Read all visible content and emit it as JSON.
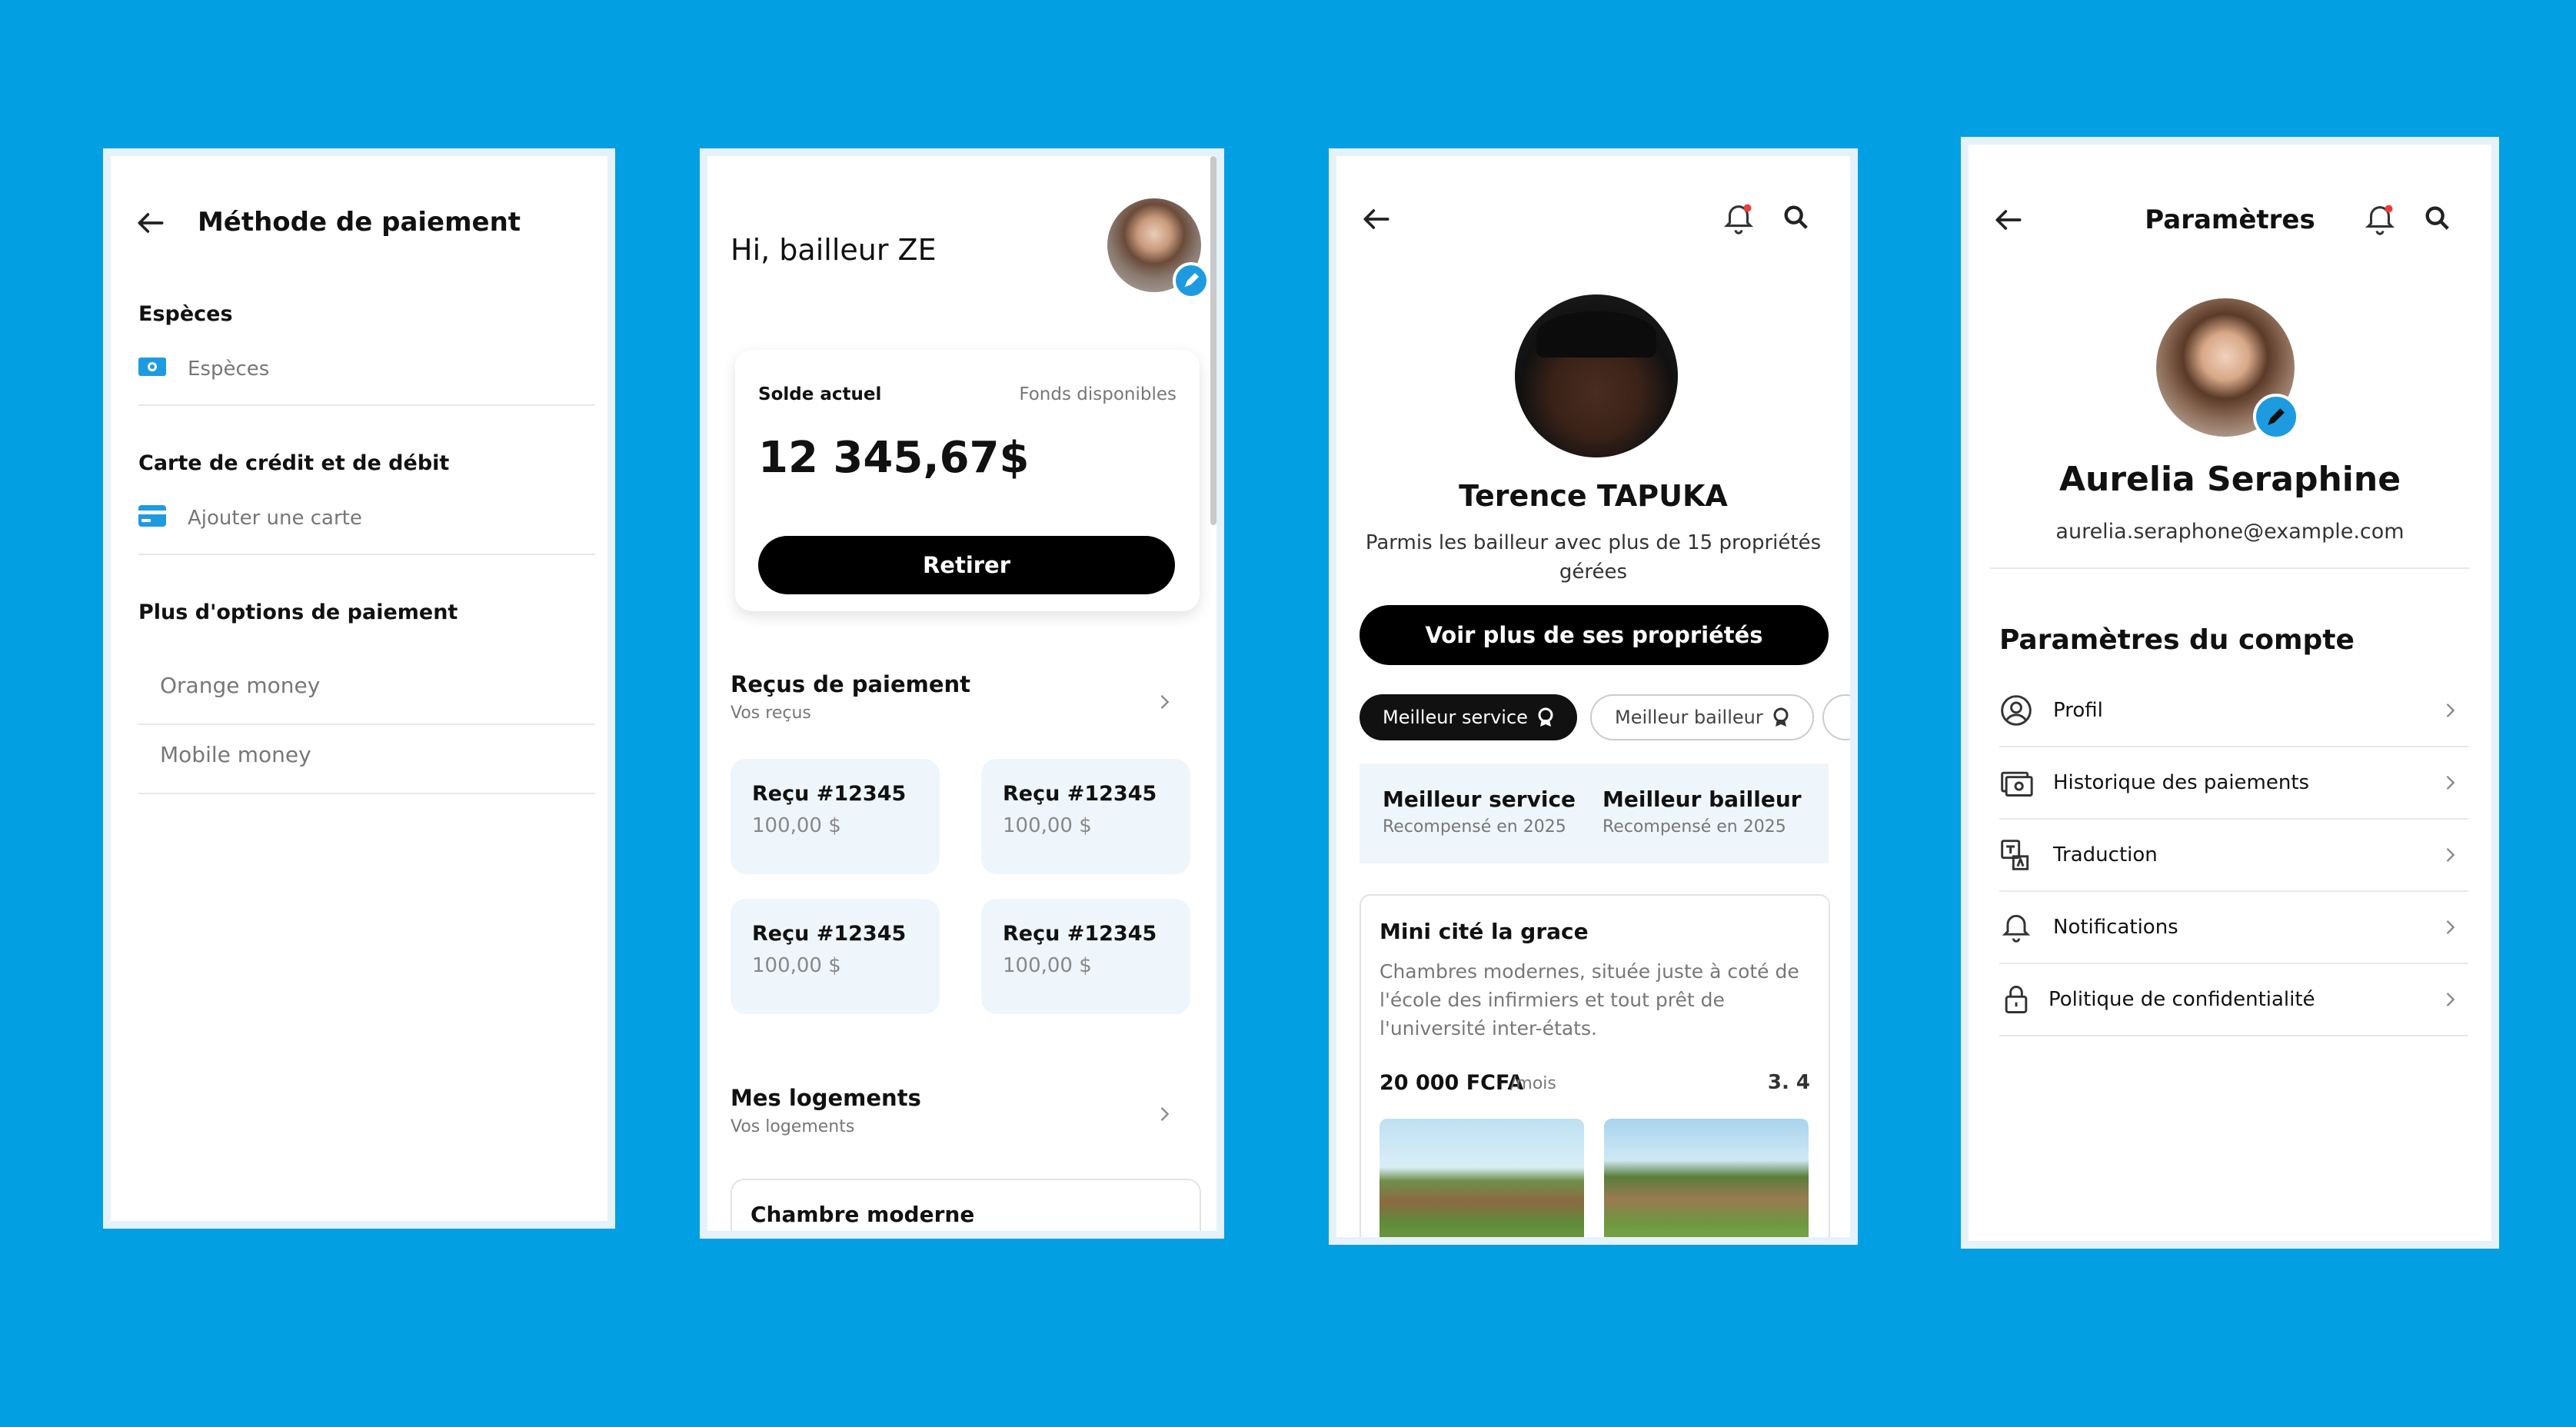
{
  "payment": {
    "title": "Méthode de paiement",
    "section_cash": "Espèces",
    "cash_item": "Espèces",
    "section_card": "Carte de crédit et de débit",
    "card_item": "Ajouter une carte",
    "section_more": "Plus d'options de paiement",
    "more_items": [
      "Orange money",
      "Mobile money"
    ]
  },
  "dashboard": {
    "greeting": "Hi, bailleur ZE",
    "balance_label": "Solde actuel",
    "funds_label": "Fonds disponibles",
    "balance": "12 345,67$",
    "withdraw": "Retirer",
    "receipts_title": "Reçus de paiement",
    "receipts_sub": "Vos reçus",
    "receipts": [
      {
        "title": "Reçu #12345",
        "amount": "100,00 $"
      },
      {
        "title": "Reçu #12345",
        "amount": "100,00 $"
      },
      {
        "title": "Reçu #12345",
        "amount": "100,00 $"
      },
      {
        "title": "Reçu #12345",
        "amount": "100,00 $"
      }
    ],
    "housing_title": "Mes logements",
    "housing_sub": "Vos logements",
    "housing_card": "Chambre moderne"
  },
  "profile": {
    "name": "Terence TAPUKA",
    "desc": "Parmis les bailleur avec plus de 15 propriétés gérées",
    "cta": "Voir plus de ses propriétés",
    "pills": [
      "Meilleur service",
      "Meilleur bailleur"
    ],
    "awards": [
      {
        "title": "Meilleur service",
        "sub": "Recompensé en 2025"
      },
      {
        "title": "Meilleur bailleur",
        "sub": "Recompensé en 2025"
      }
    ],
    "listing": {
      "title": "Mini cité la grace",
      "desc": "Chambres modernes, située juste à coté de l'école des infirmiers et tout prêt de l'université inter-états.",
      "price": "20 000 FCFA",
      "unit": "/mois",
      "rating": "3. 4"
    }
  },
  "settings": {
    "title": "Paramètres",
    "name": "Aurelia Seraphine",
    "email": "aurelia.seraphone@example.com",
    "section": "Paramètres du compte",
    "items": [
      "Profil",
      "Historique des paiements",
      "Traduction",
      "Notifications",
      "Politique de confidentialité"
    ]
  },
  "colors": {
    "background": "#039fe3",
    "accent": "#1e9be0",
    "notif": "#ee3b3b"
  }
}
